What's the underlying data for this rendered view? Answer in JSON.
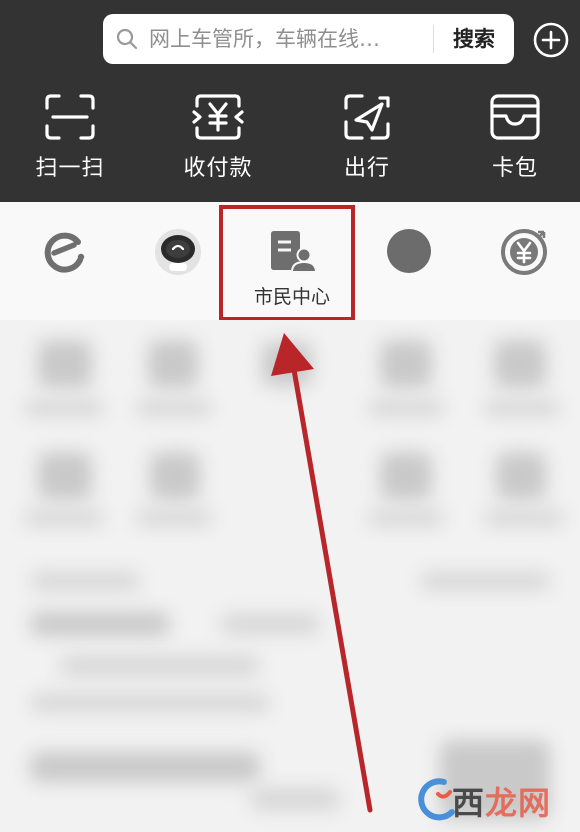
{
  "search": {
    "placeholder": "网上车管所，车辆在线…",
    "button_label": "搜索"
  },
  "quick_actions": [
    {
      "label": "扫一扫",
      "icon": "scan-icon"
    },
    {
      "label": "收付款",
      "icon": "payment-icon"
    },
    {
      "label": "出行",
      "icon": "travel-icon"
    },
    {
      "label": "卡包",
      "icon": "wallet-icon"
    }
  ],
  "apps": [
    {
      "icon": "e-logo-icon"
    },
    {
      "icon": "robot-avatar-icon"
    },
    {
      "icon": "citizen-center-icon",
      "label": "市民中心",
      "highlighted": true
    },
    {
      "icon": "gray-circle-icon"
    },
    {
      "icon": "yuan-coin-icon"
    }
  ],
  "watermark": {
    "text_plain": "西",
    "text_accent": "龙网",
    "logo_icon": "guangxi-logo-icon"
  },
  "colors": {
    "header_bg": "#333333",
    "highlight": "#b8262a",
    "arrow": "#b8262a"
  }
}
